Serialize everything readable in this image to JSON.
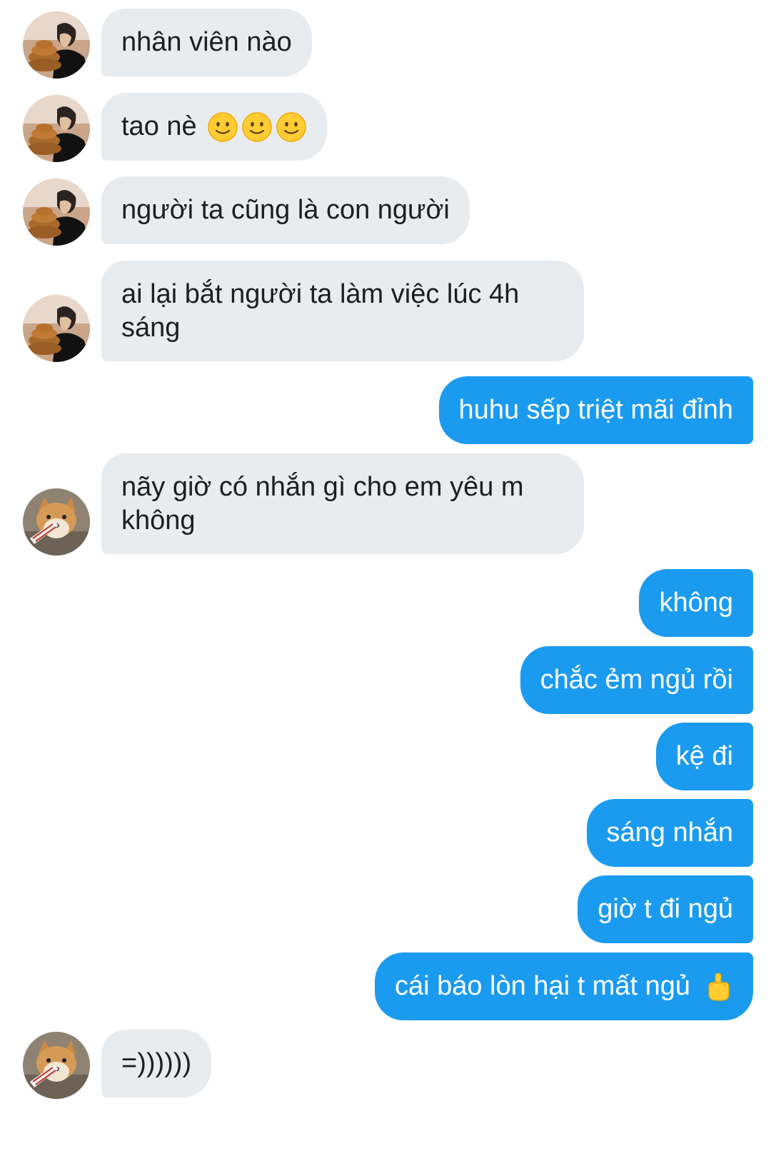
{
  "messages": [
    {
      "side": "in",
      "avatar": "person-avatar",
      "text": "nhân viên nào"
    },
    {
      "side": "in",
      "avatar": "person-avatar",
      "text": "tao nè",
      "emoji": [
        "slightly-smiling-face",
        "slightly-smiling-face",
        "slightly-smiling-face"
      ]
    },
    {
      "side": "in",
      "avatar": "person-avatar",
      "text": "người ta cũng là con người"
    },
    {
      "side": "in",
      "avatar": "person-avatar",
      "text": "ai lại bắt người ta làm việc lúc 4h sáng"
    },
    {
      "side": "out",
      "text": "huhu sếp triệt mãi đỉnh"
    },
    {
      "side": "in",
      "avatar": "dog-avatar",
      "text": "nãy giờ có nhắn gì cho em yêu m không"
    },
    {
      "side": "out",
      "text": "không"
    },
    {
      "side": "out",
      "text": "chắc ẻm ngủ rồi"
    },
    {
      "side": "out",
      "text": "kệ đi"
    },
    {
      "side": "out",
      "text": "sáng nhắn"
    },
    {
      "side": "out",
      "text": "giờ t đi ngủ"
    },
    {
      "side": "out",
      "text": "cái báo lòn hại t mất ngủ",
      "emoji": [
        "middle-finger"
      ]
    },
    {
      "side": "in",
      "avatar": "dog-avatar",
      "text": "=))))))"
    }
  ],
  "colors": {
    "incoming_bubble": "#e9ecef",
    "outgoing_bubble": "#1a9bf0",
    "incoming_text": "#1c1e21",
    "outgoing_text": "#ffffff",
    "background": "#ffffff"
  }
}
